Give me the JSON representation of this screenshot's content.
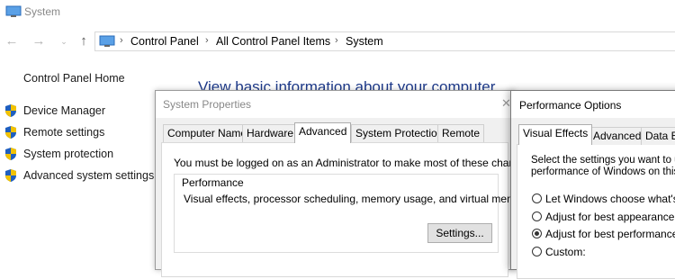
{
  "window": {
    "title": "System"
  },
  "address": {
    "crumbs": [
      "Control Panel",
      "All Control Panel Items",
      "System"
    ]
  },
  "sidebar": {
    "home": "Control Panel Home",
    "links": [
      "Device Manager",
      "Remote settings",
      "System protection",
      "Advanced system settings"
    ]
  },
  "main": {
    "heading": "View basic information about your computer"
  },
  "system_properties": {
    "title": "System Properties",
    "tabs": [
      "Computer Name",
      "Hardware",
      "Advanced",
      "System Protection",
      "Remote"
    ],
    "active_tab": "Advanced",
    "admin_note": "You must be logged on as an Administrator to make most of these changes.",
    "performance_group": "Performance",
    "performance_desc": "Visual effects, processor scheduling, memory usage, and virtual memory",
    "settings_button": "Settings..."
  },
  "performance_options": {
    "title": "Performance Options",
    "tabs": [
      "Visual Effects",
      "Advanced",
      "Data E"
    ],
    "active_tab": "Visual Effects",
    "intro_line1": "Select the settings you want to us",
    "intro_line2": "performance of Windows on this c",
    "options": [
      {
        "label": "Let Windows choose what's be",
        "checked": false
      },
      {
        "label": "Adjust for best appearance",
        "checked": false
      },
      {
        "label": "Adjust for best performance",
        "checked": true
      },
      {
        "label": "Custom:",
        "checked": false
      }
    ]
  },
  "colors": {
    "heading": "#1e3a8a",
    "shield_blue": "#1f5fbf",
    "shield_yellow": "#f2c200"
  }
}
